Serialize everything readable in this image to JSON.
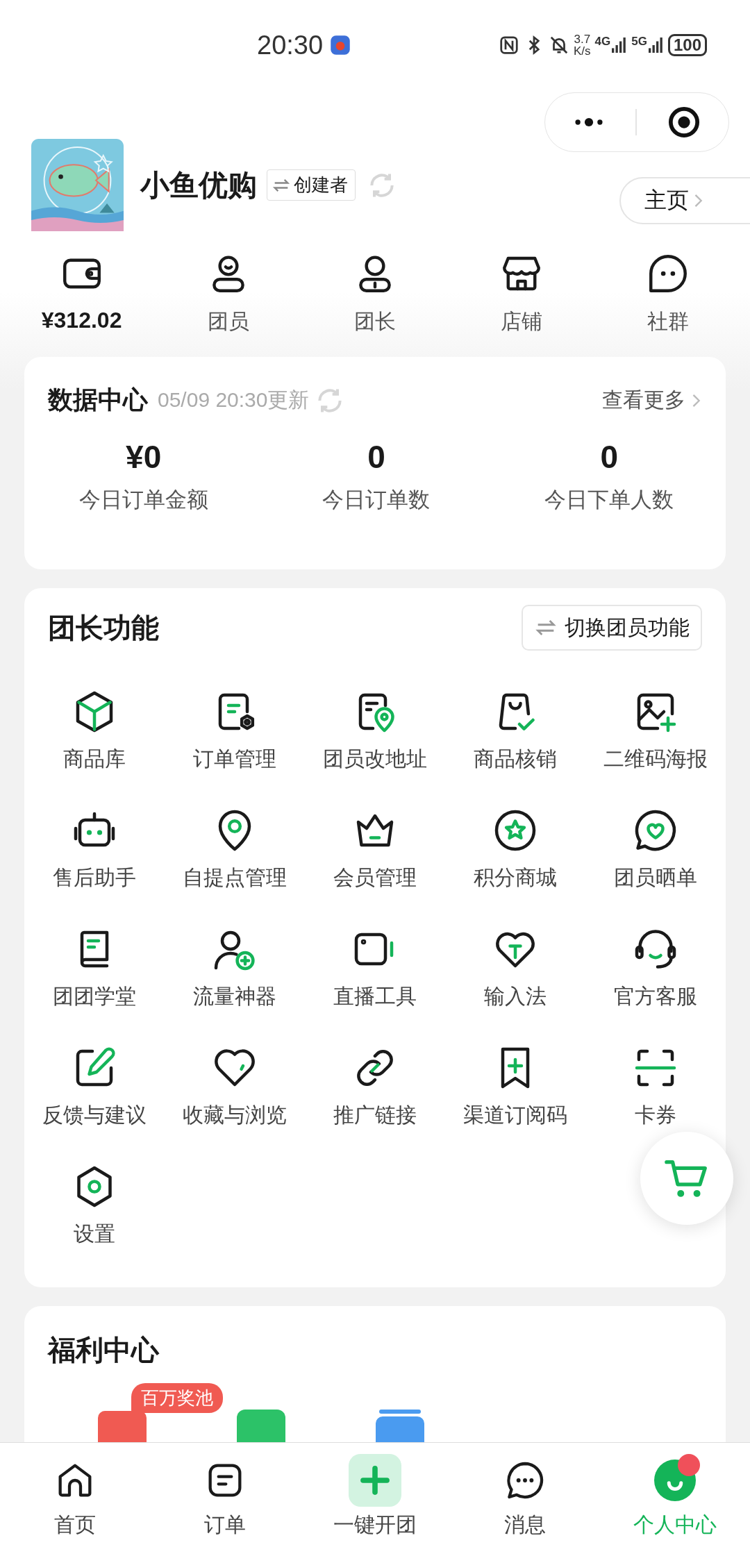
{
  "status_bar": {
    "time": "20:30",
    "speed_value": "3.7",
    "speed_unit": "K/s",
    "network_1": "4G",
    "network_2": "5G",
    "battery": "100"
  },
  "header": {
    "shop_name": "小鱼优购",
    "role_badge": "创建者",
    "home_button": "主页"
  },
  "shortcuts": [
    {
      "label": "¥312.02",
      "kind": "amount"
    },
    {
      "label": "团员",
      "kind": "label"
    },
    {
      "label": "团长",
      "kind": "label"
    },
    {
      "label": "店铺",
      "kind": "label"
    },
    {
      "label": "社群",
      "kind": "label"
    }
  ],
  "data_center": {
    "title": "数据中心",
    "updated": "05/09 20:30更新",
    "more": "查看更多",
    "stats": [
      {
        "value": "¥0",
        "label": "今日订单金额"
      },
      {
        "value": "0",
        "label": "今日订单数"
      },
      {
        "value": "0",
        "label": "今日下单人数"
      }
    ]
  },
  "functions": {
    "title": "团长功能",
    "switch_button": "切换团员功能",
    "items": [
      {
        "label": "商品库"
      },
      {
        "label": "订单管理"
      },
      {
        "label": "团员改地址"
      },
      {
        "label": "商品核销"
      },
      {
        "label": "二维码海报"
      },
      {
        "label": "售后助手"
      },
      {
        "label": "自提点管理"
      },
      {
        "label": "会员管理"
      },
      {
        "label": "积分商城"
      },
      {
        "label": "团员晒单"
      },
      {
        "label": "团团学堂"
      },
      {
        "label": "流量神器"
      },
      {
        "label": "直播工具"
      },
      {
        "label": "输入法"
      },
      {
        "label": "官方客服"
      },
      {
        "label": "反馈与建议"
      },
      {
        "label": "收藏与浏览"
      },
      {
        "label": "推广链接"
      },
      {
        "label": "渠道订阅码"
      },
      {
        "label": "卡券"
      },
      {
        "label": "设置"
      }
    ]
  },
  "welfare": {
    "title": "福利中心",
    "badge": "百万奖池"
  },
  "tab_bar": [
    {
      "label": "首页",
      "selected": false,
      "dot": false
    },
    {
      "label": "订单",
      "selected": false,
      "dot": false
    },
    {
      "label": "一键开团",
      "selected": false,
      "dot": false
    },
    {
      "label": "消息",
      "selected": false,
      "dot": false
    },
    {
      "label": "个人中心",
      "selected": true,
      "dot": true
    }
  ]
}
